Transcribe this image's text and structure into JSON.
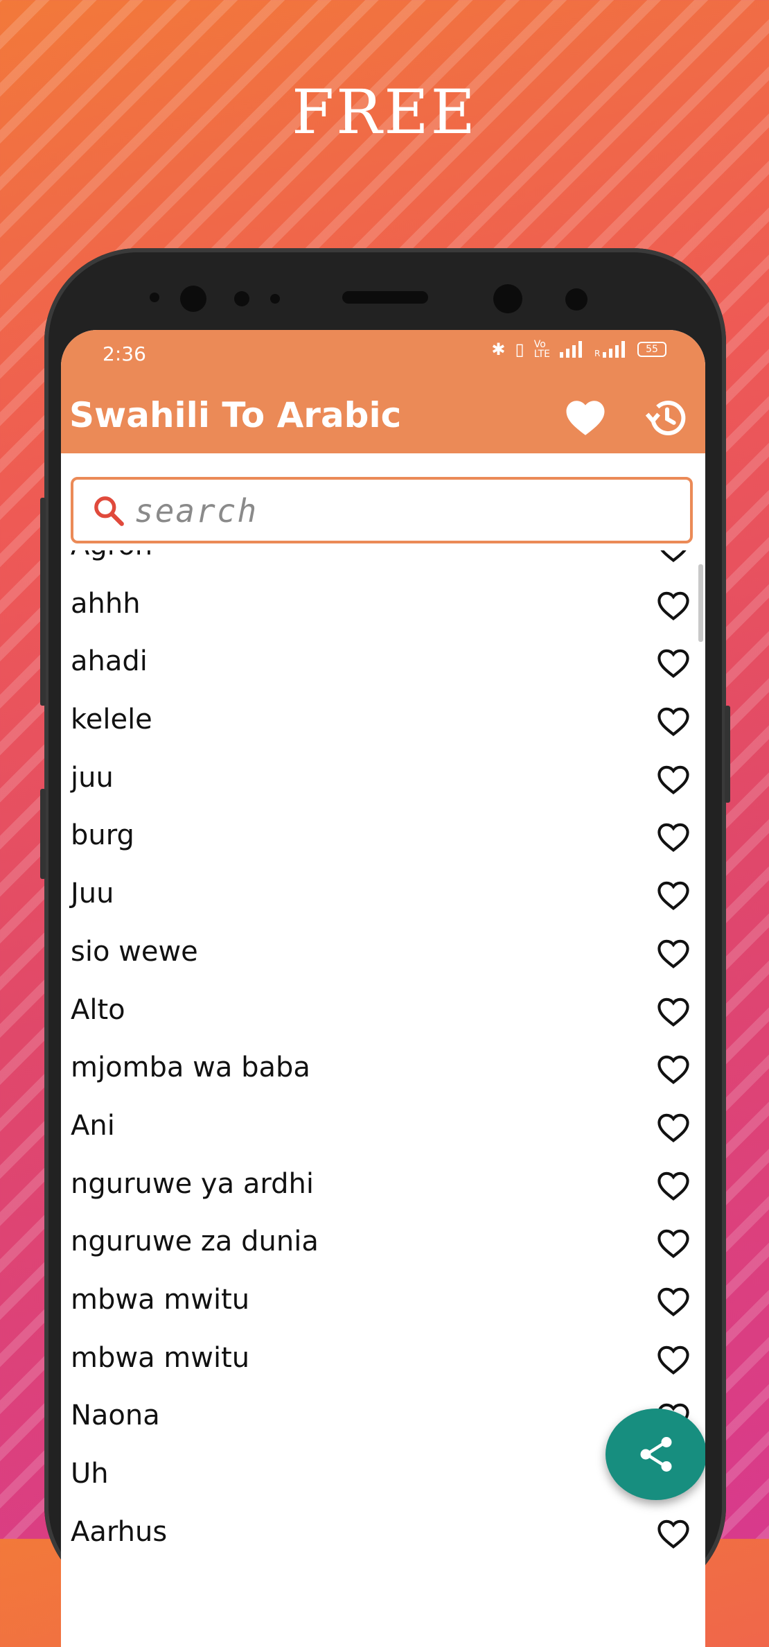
{
  "promo": {
    "title": "FREE"
  },
  "status_bar": {
    "time": "2:36",
    "battery": "55"
  },
  "app_bar": {
    "title": "Swahili To Arabic"
  },
  "search": {
    "placeholder": "search",
    "value": ""
  },
  "list": {
    "partial_top_item": "Agron",
    "items": [
      "ahhh",
      "ahadi",
      "kelele",
      "juu",
      "burg",
      "Juu",
      "sio wewe",
      "Alto",
      "mjomba wa baba",
      "Ani",
      "nguruwe ya ardhi",
      "nguruwe za dunia",
      "mbwa mwitu",
      "mbwa mwitu",
      "Naona",
      "Uh",
      "Aarhus"
    ]
  },
  "colors": {
    "accent": "#eb8a57",
    "fab": "#178e7f",
    "search_icon": "#e04a3c"
  },
  "icons": {
    "favorites": "heart-filled-icon",
    "history": "history-icon",
    "search": "search-icon",
    "row_favorite": "heart-outline-icon",
    "share": "share-icon"
  }
}
